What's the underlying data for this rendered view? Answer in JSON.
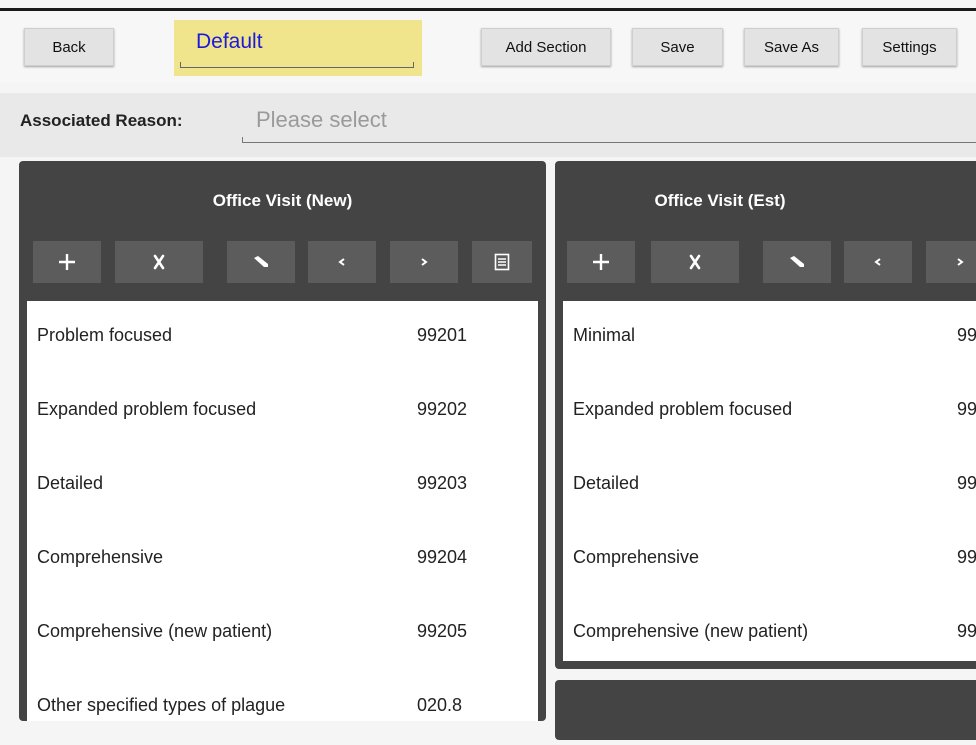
{
  "toolbar": {
    "back_label": "Back",
    "title": "Default",
    "add_section_label": "Add Section",
    "save_label": "Save",
    "save_as_label": "Save As",
    "settings_label": "Settings"
  },
  "reason": {
    "label": "Associated Reason:",
    "placeholder": "Please select"
  },
  "panels": [
    {
      "title": "Office Visit (New)",
      "toolbar_icons": [
        "plus-icon",
        "cross-icon",
        "pencil-icon",
        "chevron-left-icon",
        "chevron-right-icon",
        "list-icon"
      ],
      "items": [
        {
          "label": "Problem focused",
          "code": "99201"
        },
        {
          "label": "Expanded problem focused",
          "code": "99202"
        },
        {
          "label": "Detailed",
          "code": "99203"
        },
        {
          "label": "Comprehensive",
          "code": "99204"
        },
        {
          "label": "Comprehensive (new patient)",
          "code": "99205"
        },
        {
          "label": "Other specified types of plague",
          "code": "020.8"
        }
      ]
    },
    {
      "title": "Office Visit (Est)",
      "toolbar_icons": [
        "plus-icon",
        "cross-icon",
        "pencil-icon",
        "chevron-left-icon",
        "chevron-right-icon"
      ],
      "items": [
        {
          "label": "Minimal",
          "code": "99"
        },
        {
          "label": "Expanded problem focused",
          "code": "99"
        },
        {
          "label": "Detailed",
          "code": "99"
        },
        {
          "label": "Comprehensive",
          "code": "99"
        },
        {
          "label": "Comprehensive (new patient)",
          "code": "99"
        }
      ]
    }
  ],
  "colors": {
    "title_highlight": "#f0e58c",
    "title_text": "#1a1adb",
    "panel_bg": "#444444",
    "panel_button": "#5c5c5c"
  }
}
